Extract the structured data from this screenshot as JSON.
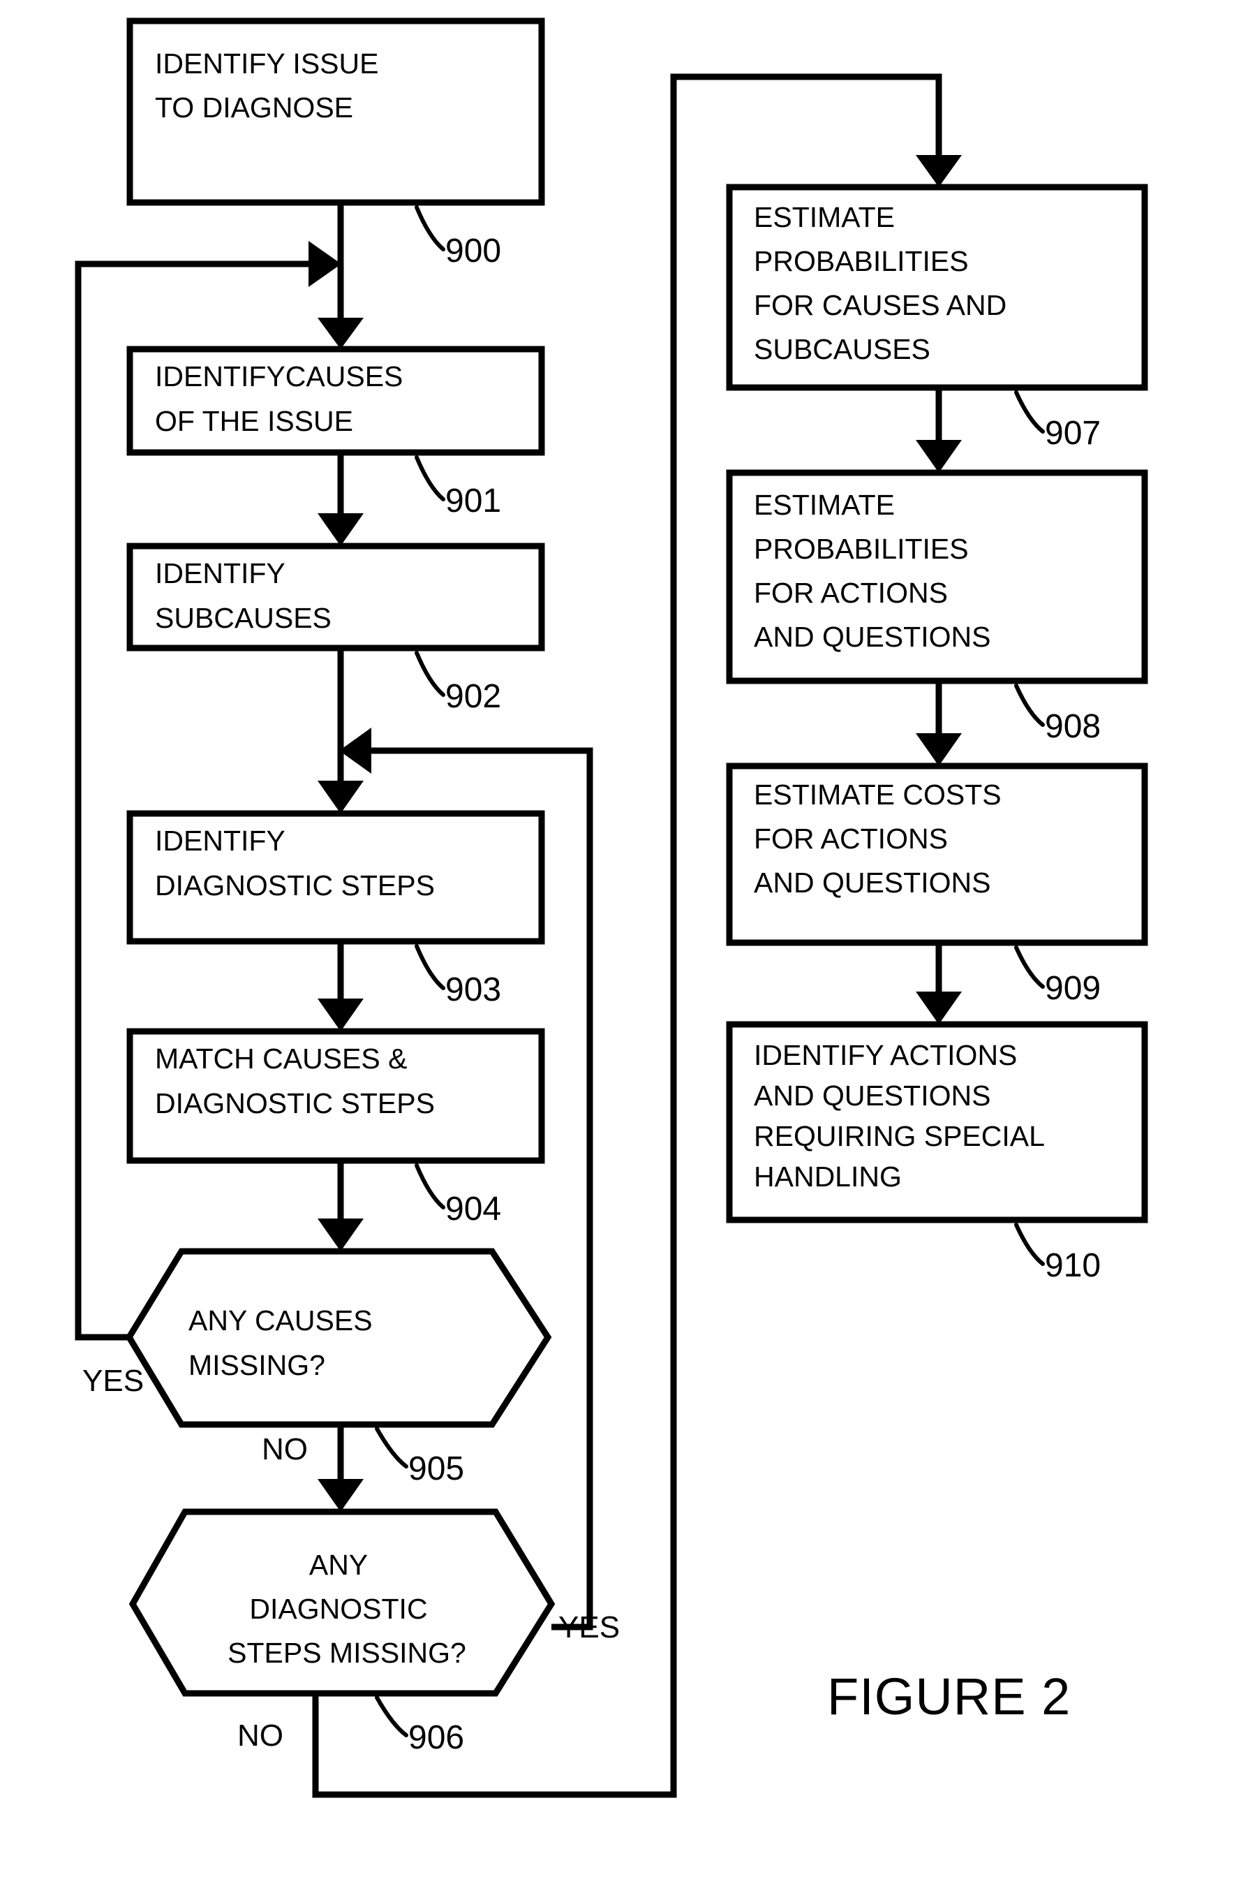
{
  "figure": {
    "label": "FIGURE 2"
  },
  "colors": {
    "ink": "#000000",
    "paper": "#ffffff"
  },
  "nodes": [
    {
      "id": "n900",
      "ref": "900",
      "shape": "process",
      "lines": [
        "IDENTIFY ISSUE",
        "TO DIAGNOSE"
      ]
    },
    {
      "id": "n901",
      "ref": "901",
      "shape": "process",
      "lines": [
        "IDENTIFYCAUSES",
        "OF THE ISSUE"
      ]
    },
    {
      "id": "n902",
      "ref": "902",
      "shape": "process",
      "lines": [
        "IDENTIFY",
        "SUBCAUSES"
      ]
    },
    {
      "id": "n903",
      "ref": "903",
      "shape": "process",
      "lines": [
        "IDENTIFY",
        "DIAGNOSTIC STEPS"
      ]
    },
    {
      "id": "n904",
      "ref": "904",
      "shape": "process",
      "lines": [
        "MATCH CAUSES &",
        "DIAGNOSTIC STEPS"
      ]
    },
    {
      "id": "n905",
      "ref": "905",
      "shape": "decision",
      "lines": [
        "ANY CAUSES",
        "MISSING?"
      ]
    },
    {
      "id": "n906",
      "ref": "906",
      "shape": "decision",
      "lines": [
        "ANY",
        "DIAGNOSTIC",
        "STEPS MISSING?"
      ]
    },
    {
      "id": "n907",
      "ref": "907",
      "shape": "process",
      "lines": [
        "ESTIMATE",
        "PROBABILITIES",
        "FOR CAUSES AND",
        "SUBCAUSES"
      ]
    },
    {
      "id": "n908",
      "ref": "908",
      "shape": "process",
      "lines": [
        "ESTIMATE",
        "PROBABILITIES",
        "FOR ACTIONS",
        "AND QUESTIONS"
      ]
    },
    {
      "id": "n909",
      "ref": "909",
      "shape": "process",
      "lines": [
        "ESTIMATE COSTS",
        "FOR ACTIONS",
        "AND QUESTIONS"
      ]
    },
    {
      "id": "n910",
      "ref": "910",
      "shape": "process",
      "lines": [
        "IDENTIFY ACTIONS",
        "AND QUESTIONS",
        "REQUIRING SPECIAL",
        "HANDLING"
      ]
    }
  ],
  "branch_labels": {
    "yes_905": "YES",
    "no_905": "NO",
    "yes_906": "YES",
    "no_906": "NO"
  },
  "text": {
    "n900_l1": "IDENTIFY ISSUE",
    "n900_l2": "TO DIAGNOSE",
    "n901_l1": "IDENTIFYCAUSES",
    "n901_l2": "OF THE ISSUE",
    "n902_l1": "IDENTIFY",
    "n902_l2": "SUBCAUSES",
    "n903_l1": "IDENTIFY",
    "n903_l2": "DIAGNOSTIC STEPS",
    "n904_l1": "MATCH CAUSES &",
    "n904_l2": "DIAGNOSTIC STEPS",
    "n905_l1": "ANY CAUSES",
    "n905_l2": "MISSING?",
    "n906_l1": "ANY",
    "n906_l2": "DIAGNOSTIC",
    "n906_l3": "STEPS MISSING?",
    "n907_l1": "ESTIMATE",
    "n907_l2": "PROBABILITIES",
    "n907_l3": "FOR CAUSES AND",
    "n907_l4": "SUBCAUSES",
    "n908_l1": "ESTIMATE",
    "n908_l2": "PROBABILITIES",
    "n908_l3": "FOR ACTIONS",
    "n908_l4": "AND QUESTIONS",
    "n909_l1": "ESTIMATE COSTS",
    "n909_l2": "FOR ACTIONS",
    "n909_l3": "AND QUESTIONS",
    "n910_l1": "IDENTIFY ACTIONS",
    "n910_l2": "AND QUESTIONS",
    "n910_l3": "REQUIRING SPECIAL",
    "n910_l4": "HANDLING"
  },
  "refs": {
    "r900": "900",
    "r901": "901",
    "r902": "902",
    "r903": "903",
    "r904": "904",
    "r905": "905",
    "r906": "906",
    "r907": "907",
    "r908": "908",
    "r909": "909",
    "r910": "910"
  },
  "chart_data": {
    "type": "diagram",
    "title": "FIGURE 2",
    "flow": [
      {
        "from": "900",
        "to": "901",
        "label": ""
      },
      {
        "from": "901",
        "to": "902",
        "label": ""
      },
      {
        "from": "902",
        "to": "903",
        "label": ""
      },
      {
        "from": "903",
        "to": "904",
        "label": ""
      },
      {
        "from": "904",
        "to": "905",
        "label": ""
      },
      {
        "from": "905",
        "to": "901",
        "label": "YES"
      },
      {
        "from": "905",
        "to": "906",
        "label": "NO"
      },
      {
        "from": "906",
        "to": "903",
        "label": "YES"
      },
      {
        "from": "906",
        "to": "907",
        "label": "NO"
      },
      {
        "from": "907",
        "to": "908",
        "label": ""
      },
      {
        "from": "908",
        "to": "909",
        "label": ""
      },
      {
        "from": "909",
        "to": "910",
        "label": ""
      }
    ]
  }
}
